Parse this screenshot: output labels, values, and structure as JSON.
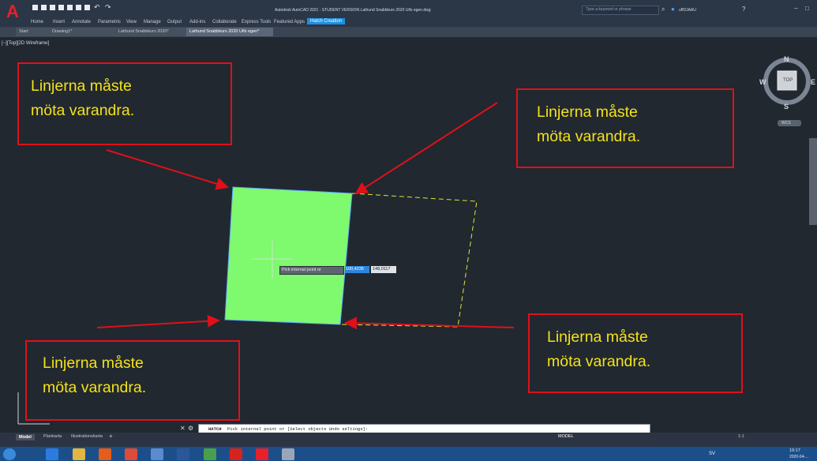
{
  "app": {
    "title": "Autodesk AutoCAD 2021 - STUDENT VERSION   Lathund Snabbkurs 2020 Uifs egen.dwg",
    "search_placeholder": "Type a keyword or phrase",
    "user": "uffDJAAU",
    "logo_letter": "A"
  },
  "ribbon_tabs": [
    "Home",
    "Insert",
    "Annotate",
    "Parametric",
    "View",
    "Manage",
    "Output",
    "Add-ins",
    "Collaborate",
    "Express Tools",
    "Featured Apps",
    "Hatch Creation"
  ],
  "doc_tabs": [
    "Start",
    "Drawing1*",
    "Lathund Snabbkurs 2020*",
    "Lathund Snabbkurs 2020 Uifs egen*"
  ],
  "viewport_label": "[−][Top][2D Wireframe]",
  "viewcube": {
    "n": "N",
    "s": "S",
    "e": "E",
    "w": "W",
    "top": "TOP",
    "wcs": "WCS"
  },
  "callouts": [
    {
      "line1": "Linjerna måste",
      "line2": "möta varandra."
    },
    {
      "line1": "Linjerna måste",
      "line2": "möta varandra."
    },
    {
      "line1": "Linjerna måste",
      "line2": "möta varandra."
    },
    {
      "line1": "Linjerna måste",
      "line2": "möta varandra."
    }
  ],
  "tooltip": {
    "prompt": "Pick internal point or",
    "x_value": "100,4235",
    "y_value": "148,0117"
  },
  "command": {
    "prefix": "HATCH",
    "text": "Pick internal point or [Select objects Undo seTtings]:"
  },
  "layout_tabs": [
    "Model",
    "Plankarta",
    "Illustrationskarta"
  ],
  "status": {
    "mode": "MODEL",
    "scale": "1:1"
  },
  "taskbar": {
    "lang": "SV",
    "time": "19:17",
    "date": "2020-04-..."
  },
  "colors": {
    "hatch_fill": "#7ff96e",
    "callout_border": "#e0101a",
    "callout_text": "#f4e21a",
    "arrow": "#e0101a",
    "background": "#212830"
  }
}
